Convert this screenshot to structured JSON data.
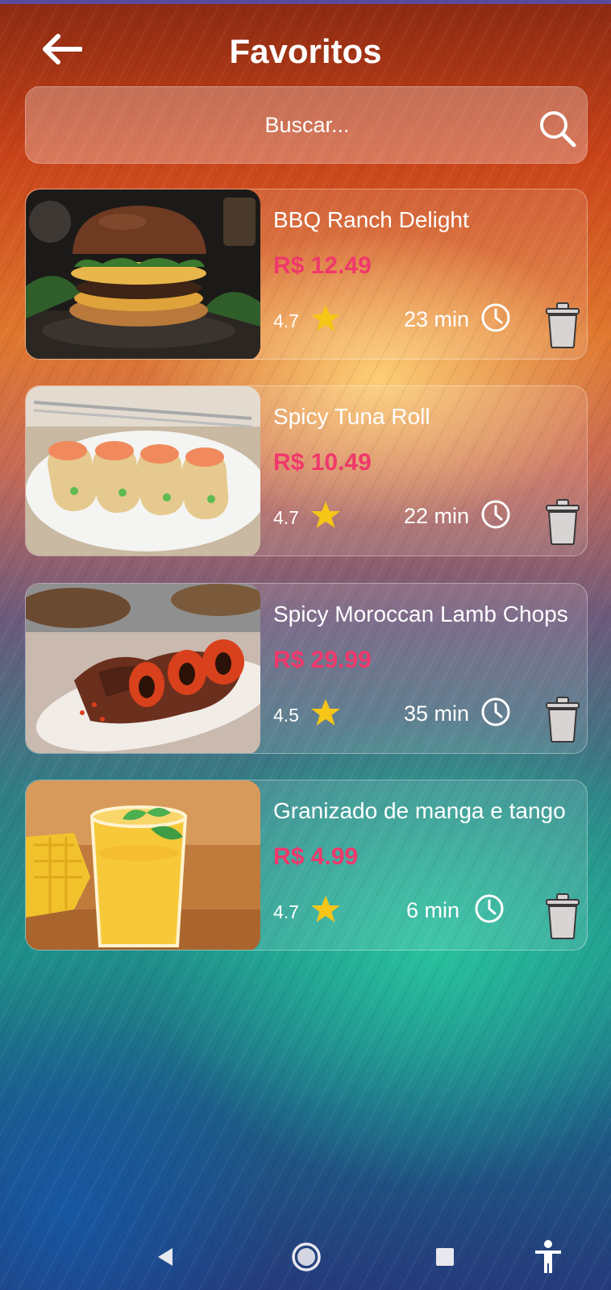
{
  "header": {
    "title": "Favoritos"
  },
  "search": {
    "placeholder": "Buscar..."
  },
  "favorites": [
    {
      "name": "BBQ Ranch Delight",
      "price": "R$ 12.49",
      "rating": "4.7",
      "time": "23 min",
      "image": "burger"
    },
    {
      "name": "Spicy Tuna Roll",
      "price": "R$ 10.49",
      "rating": "4.7",
      "time": "22 min",
      "image": "tuna-wraps"
    },
    {
      "name": "Spicy Moroccan Lamb Chops",
      "price": "R$ 29.99",
      "rating": "4.5",
      "time": "35 min",
      "image": "lamb-chops"
    },
    {
      "name": "Granizado de manga e tango",
      "price": "R$ 4.99",
      "rating": "4.7",
      "time": "6 min",
      "image": "mango-drink"
    }
  ],
  "colors": {
    "price": "#f0386b",
    "star": "#f5c518",
    "text": "#ffffff",
    "trash": "#d9d4d4"
  },
  "icons": {
    "back": "arrow-left-icon",
    "search": "search-icon",
    "star": "star-icon",
    "clock": "clock-icon",
    "trash": "trash-icon"
  },
  "navbar": {
    "items": [
      "back-triangle-icon",
      "home-circle-icon",
      "recents-square-icon",
      "accessibility-icon"
    ]
  }
}
